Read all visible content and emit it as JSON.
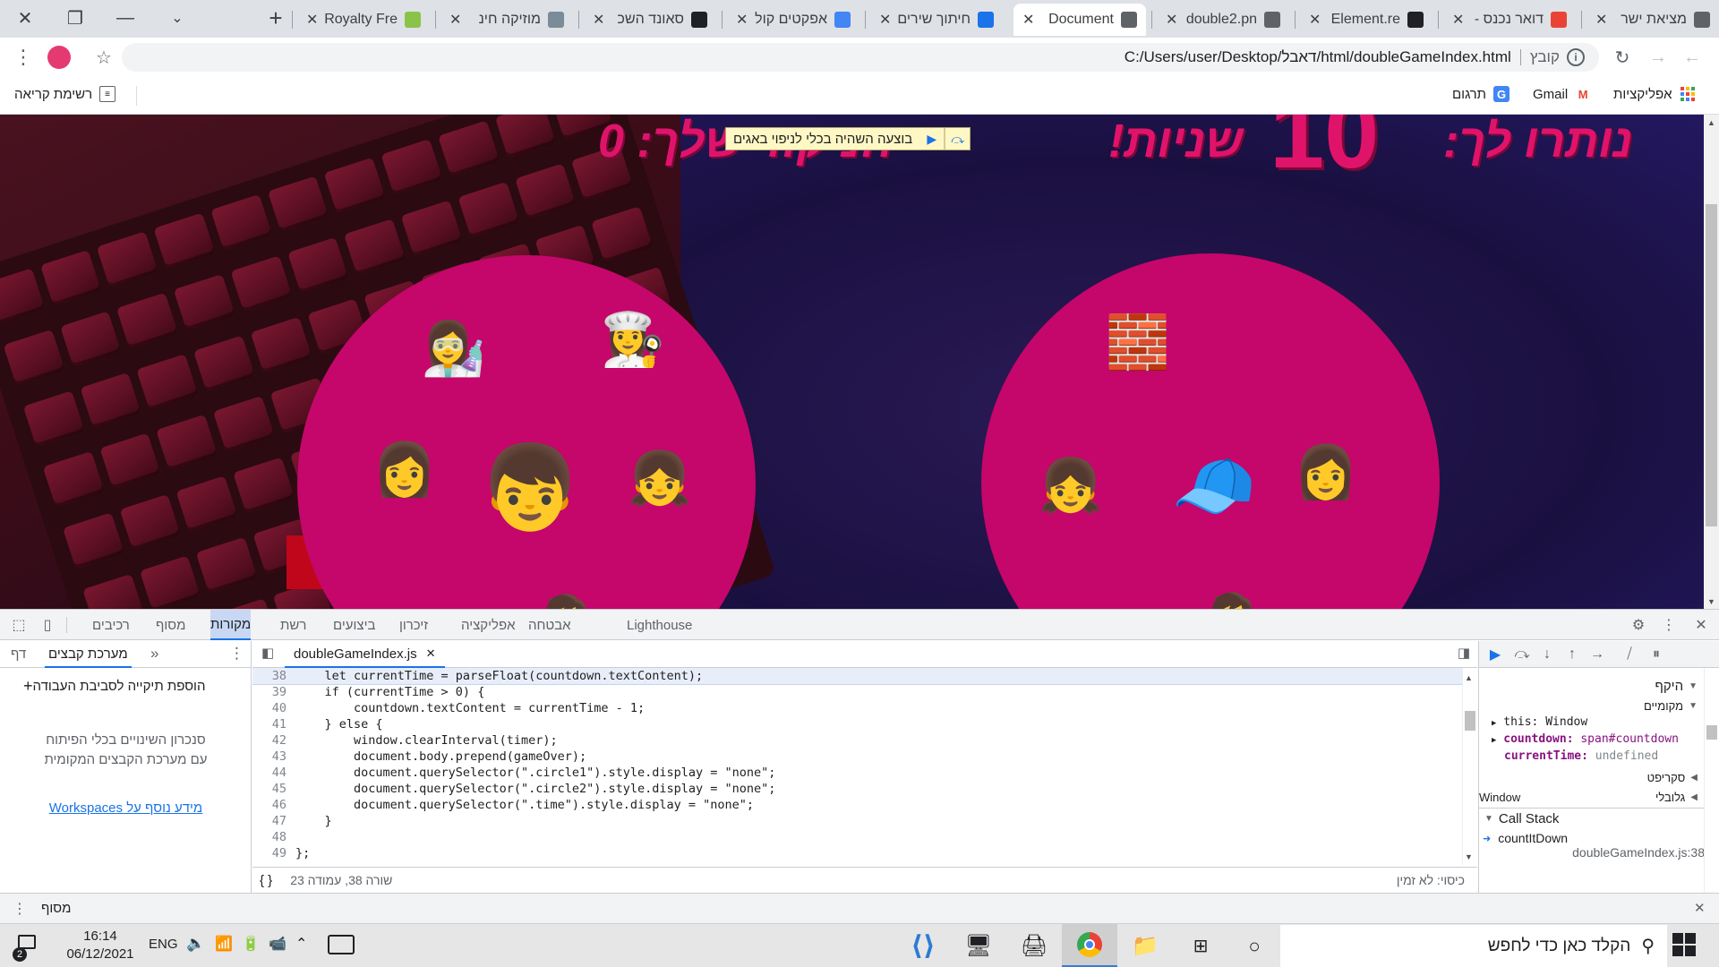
{
  "tabs": [
    {
      "title": "מציאת ישר",
      "favicon": "globe-icon",
      "color": "#5f6368"
    },
    {
      "title": "דואר נכנס -",
      "favicon": "gmail-icon",
      "color": "#ea4335"
    },
    {
      "title": "Element.re",
      "favicon": "element-icon",
      "color": "#202124"
    },
    {
      "title": "double2.pn",
      "favicon": "globe-icon",
      "color": "#5f6368"
    },
    {
      "title": "Document",
      "favicon": "globe-icon",
      "color": "#5f6368",
      "active": true
    },
    {
      "title": "חיתוך שירים",
      "favicon": "music-note-icon",
      "color": "#1a73e8"
    },
    {
      "title": "אפקטים קוליים",
      "favicon": "google-icon",
      "color": "#4285f4"
    },
    {
      "title": "סאונד השכ",
      "favicon": "speaker-icon",
      "color": "#202124"
    },
    {
      "title": "מוזיקה חינ",
      "favicon": "picture-icon",
      "color": "#7b8c99"
    },
    {
      "title": "Royalty Fre",
      "favicon": "b-logo-icon",
      "color": "#8bc34a"
    }
  ],
  "address": {
    "scheme_label": "קובץ",
    "url": "C:/Users/user/Desktop/דאבל/html/doubleGameIndex.html"
  },
  "bookmarks": {
    "apps": "אפליקציות",
    "gmail": "Gmail",
    "translate": "תרגום",
    "reading_list": "רשימת קריאה"
  },
  "page": {
    "headline_right": "נותרו לך:",
    "headline_number": "10",
    "headline_seconds": "שניות!",
    "headline_left": "הניקוד שלך: 0",
    "perf_banner": "בוצעה השהיה בכלי לניפוי באגים",
    "circle_color": "#c5066b",
    "accent_color": "#e0136b"
  },
  "devtools": {
    "tabs": [
      "רכיבים",
      "מסוף",
      "מקורות",
      "רשת",
      "ביצועים",
      "זיכרון",
      "אפליקציה",
      "אבטחה",
      "Lighthouse"
    ],
    "selected_tab": "מקורות",
    "nav_tabs": [
      "דף",
      "מערכת קבצים"
    ],
    "add_folder": "הוספת תיקייה לסביבת העבודה",
    "sync_hint_1": "סנכרון השינויים בכלי הפיתוח",
    "sync_hint_2": "עם מערכת הקבצים המקומית",
    "workspaces_link": "מידע נוסף על Workspaces",
    "file_tab": "doubleGameIndex.js",
    "status_position": "שורה 38, עמודה 23",
    "status_coverage": "כיסוי: לא זמין",
    "code": [
      {
        "n": "38",
        "t": "    let currentTime = parseFloat(countdown.textContent);"
      },
      {
        "n": "39",
        "t": "    if (currentTime > 0) {"
      },
      {
        "n": "40",
        "t": "        countdown.textContent = currentTime - 1;"
      },
      {
        "n": "41",
        "t": "    } else {"
      },
      {
        "n": "42",
        "t": "        window.clearInterval(timer);"
      },
      {
        "n": "43",
        "t": "        document.body.prepend(gameOver);"
      },
      {
        "n": "44",
        "t": "        document.querySelector(\".circle1\").style.display = \"none\";"
      },
      {
        "n": "45",
        "t": "        document.querySelector(\".circle2\").style.display = \"none\";"
      },
      {
        "n": "46",
        "t": "        document.querySelector(\".time\").style.display = \"none\";"
      },
      {
        "n": "47",
        "t": "    }"
      },
      {
        "n": "48",
        "t": ""
      },
      {
        "n": "49",
        "t": "};"
      }
    ],
    "scope": {
      "title": "היקף",
      "local": "מקומיים",
      "this_key": "this:",
      "this_val": "Window",
      "countdown_key": "countdown:",
      "countdown_val": "span#countdown",
      "current_key": "currentTime:",
      "current_val": "undefined",
      "script": "סקריפט",
      "global": "גלובלי",
      "global_val": "Window"
    },
    "callstack": {
      "title": "Call Stack",
      "fn": "countItDown",
      "loc": "doubleGameIndex.js:38"
    },
    "drawer_label": "מסוף"
  },
  "taskbar": {
    "search_placeholder": "הקלד כאן כדי לחפש",
    "time": "16:14",
    "date": "06/12/2021",
    "lang": "ENG",
    "notif_count": "2"
  }
}
